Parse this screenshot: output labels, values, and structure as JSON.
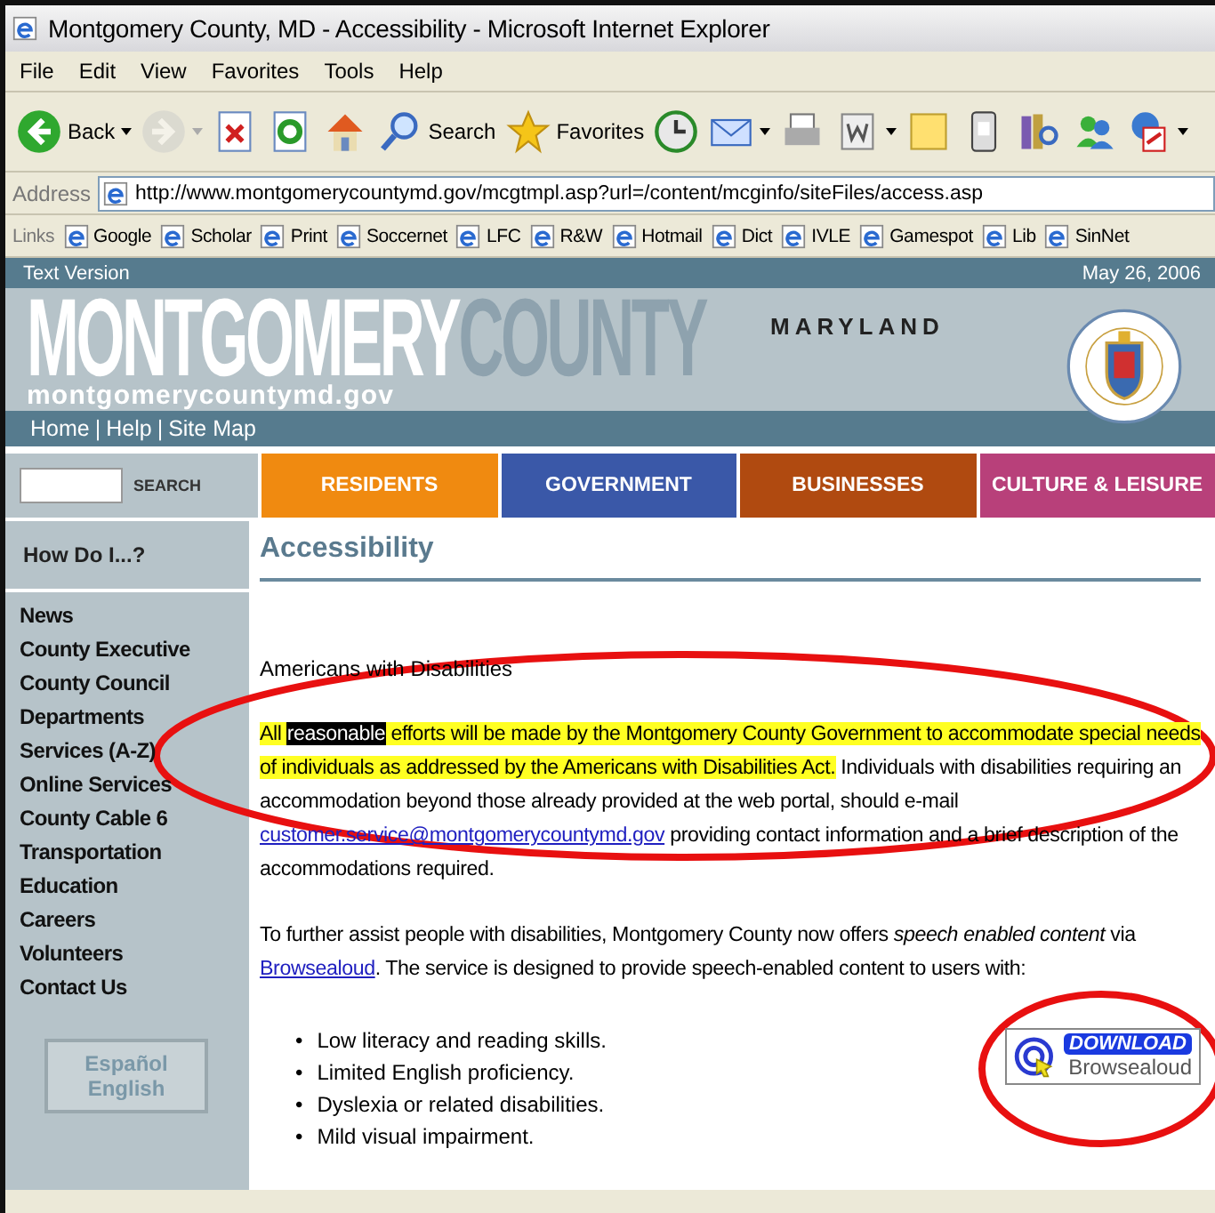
{
  "window": {
    "title": "Montgomery County, MD - Accessibility - Microsoft Internet Explorer"
  },
  "menu": [
    "File",
    "Edit",
    "View",
    "Favorites",
    "Tools",
    "Help"
  ],
  "toolbar": [
    {
      "label": "Back",
      "dropdown": true,
      "disabled": false
    },
    {
      "dropdown": true,
      "disabled": true
    },
    {
      "dropdown": false,
      "disabled": false
    },
    {
      "dropdown": false,
      "disabled": false
    },
    {
      "dropdown": false,
      "disabled": false
    },
    {
      "label": "Search",
      "dropdown": false,
      "disabled": false
    },
    {
      "label": "Favorites",
      "dropdown": false,
      "disabled": false
    },
    {
      "dropdown": false,
      "disabled": false
    },
    {
      "dropdown": true,
      "disabled": false
    },
    {
      "dropdown": false,
      "disabled": false
    },
    {
      "dropdown": true,
      "disabled": false
    },
    {
      "dropdown": false,
      "disabled": false
    },
    {
      "dropdown": false,
      "disabled": false
    },
    {
      "dropdown": false,
      "disabled": false
    },
    {
      "dropdown": false,
      "disabled": false
    },
    {
      "dropdown": true,
      "disabled": false
    }
  ],
  "address_bar": {
    "label": "Address",
    "value": "http://www.montgomerycountymd.gov/mcgtmpl.asp?url=/content/mcginfo/siteFiles/access.asp"
  },
  "links_bar": {
    "label": "Links",
    "items": [
      "Google",
      "Scholar",
      "Print",
      "Soccernet",
      "LFC",
      "R&W",
      "Hotmail",
      "Dict",
      "IVLE",
      "Gamespot",
      "Lib",
      "SinNet"
    ]
  },
  "page": {
    "top_strip": {
      "text_version": "Text Version",
      "date": "May 26, 2006"
    },
    "banner": {
      "title_primary": "MONTGOMERY",
      "title_secondary": "COUNTY",
      "state": "MARYLAND",
      "domain": "montgomerycountymd.gov"
    },
    "utility_links": {
      "separator": "|",
      "items": [
        "Home",
        "Help",
        "Site Map"
      ]
    },
    "search": {
      "button": "SEARCH"
    },
    "nav_tabs": [
      {
        "label": "RESIDENTS",
        "color": "#f08a10"
      },
      {
        "label": "GOVERNMENT",
        "color": "#3a58a8"
      },
      {
        "label": "BUSINESSES",
        "color": "#b04a10"
      },
      {
        "label": "CULTURE & LEISURE",
        "color": "#b8407a"
      }
    ],
    "sidebar": {
      "heading": "How Do I...?",
      "items": [
        "News",
        "County Executive",
        "County Council",
        "Departments",
        "Services (A-Z)",
        "Online Services",
        "County Cable 6",
        "Transportation",
        "Education",
        "Careers",
        "Volunteers",
        "Contact Us"
      ],
      "language_button": [
        "Español",
        "English"
      ]
    },
    "content": {
      "heading": "Accessibility",
      "subheading": "Americans with Disabilities",
      "paragraph_1": [
        {
          "kind": "highlight",
          "text": "All "
        },
        {
          "kind": "selected",
          "text": "reasonable"
        },
        {
          "kind": "highlight",
          "text": " efforts will be made by the Montgomery County Government to accommodate special needs of individuals as addressed by the Americans with Disabilities Act."
        },
        {
          "kind": "plain",
          "text": " Individuals with disabilities requiring an accommodation beyond those already provided at the web portal, should e-mail "
        },
        {
          "kind": "link",
          "text": "customer.service@montgomerycountymd.gov"
        },
        {
          "kind": "plain",
          "text": " providing contact information and a brief description of the accommodations required."
        }
      ],
      "paragraph_2": [
        {
          "kind": "plain",
          "text": "To further assist people with disabilities, Montgomery County now offers "
        },
        {
          "kind": "italic",
          "text": "speech enabled content"
        },
        {
          "kind": "plain",
          "text": " via "
        },
        {
          "kind": "link",
          "text": "Browsealoud"
        },
        {
          "kind": "plain",
          "text": ". The service is designed to provide speech-enabled content to users with:"
        }
      ],
      "list_marker": "•",
      "list": [
        "Low literacy and reading skills.",
        "Limited English proficiency.",
        "Dyslexia or related disabilities.",
        "Mild visual impairment."
      ],
      "download_badge": {
        "action": "DOWNLOAD",
        "product": "Browsealoud"
      }
    }
  }
}
